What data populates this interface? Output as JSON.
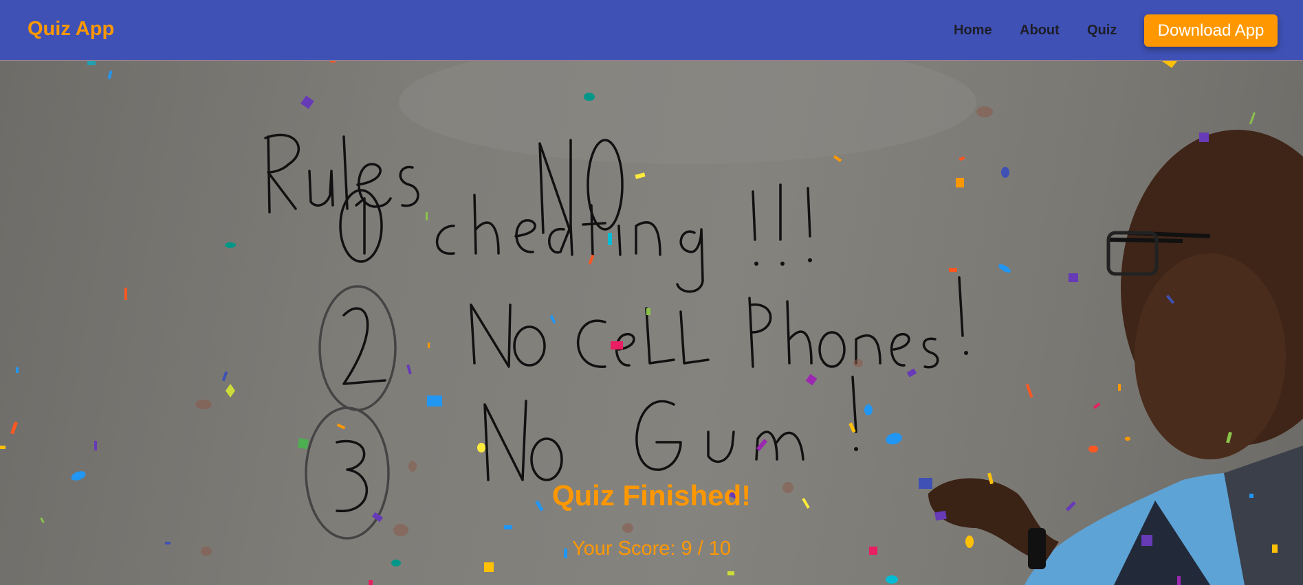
{
  "header": {
    "brand": "Quiz App",
    "nav": [
      {
        "label": "Home"
      },
      {
        "label": "About"
      },
      {
        "label": "Quiz"
      }
    ],
    "download_button": "Download App"
  },
  "result": {
    "title": "Quiz Finished!",
    "score": "Your Score: 9 / 10"
  },
  "colors": {
    "navbar": "#3f51b5",
    "accent": "#ff9800",
    "nav_text": "#1e1e28"
  }
}
